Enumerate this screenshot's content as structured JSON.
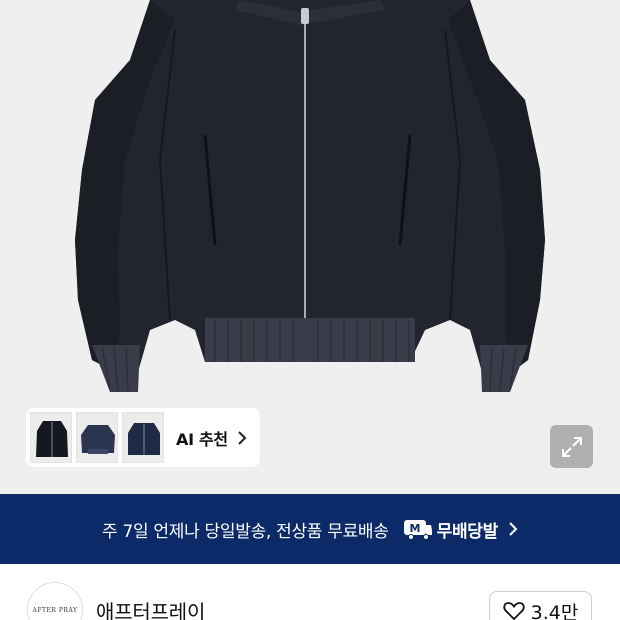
{
  "product_image": {
    "icon": "jacket-photo"
  },
  "ai_recommend": {
    "label": "AI 추천",
    "thumbnails": [
      "dark-jacket-thumb",
      "navy-bomber-thumb",
      "navy-jacket-thumb"
    ]
  },
  "expand": {
    "icon": "expand-icon"
  },
  "delivery_banner": {
    "text": "주 7일 언제나 당일발송, 전상품 무료배송",
    "badge_icon": "M",
    "badge_label": "무배당발",
    "background": "#0c2a68"
  },
  "brand": {
    "logo_text": "AFTER PRAY",
    "name": "애프터프레이",
    "likes": "3.4만"
  }
}
